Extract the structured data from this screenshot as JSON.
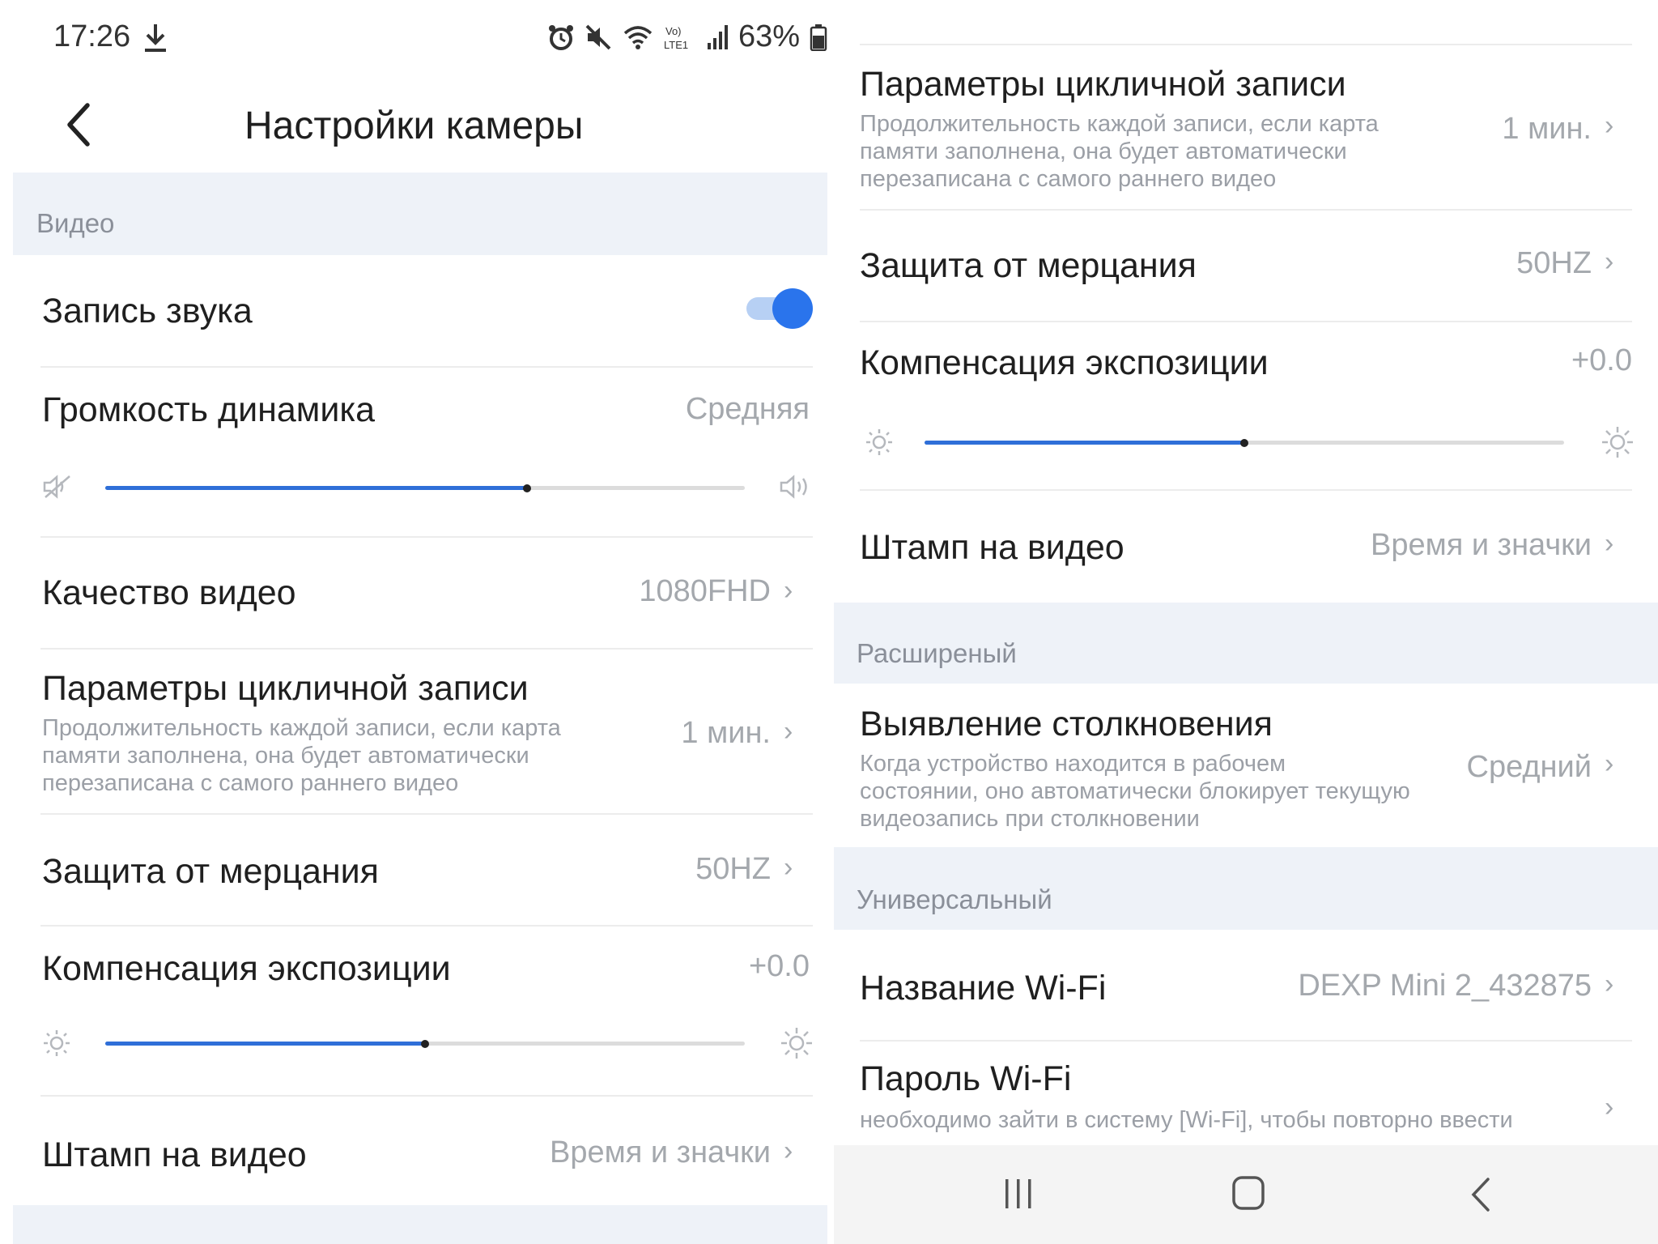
{
  "status_bar": {
    "time": "17:26",
    "battery": "63%",
    "icons": [
      "download-icon",
      "alarm-icon",
      "mute-icon",
      "wifi-icon",
      "volte-icon",
      "signal-icon",
      "battery-icon"
    ]
  },
  "header": {
    "title": "Настройки камеры",
    "back_icon": "back-icon"
  },
  "left": {
    "sections": {
      "video": "Видео"
    },
    "sound_record": {
      "label": "Запись звука",
      "enabled": true
    },
    "speaker_volume": {
      "label": "Громкость динамика",
      "value": "Средняя",
      "level_fraction": 0.66
    },
    "video_quality": {
      "label": "Качество видео",
      "value": "1080FHD"
    },
    "loop_recording": {
      "label": "Параметры цикличной записи",
      "desc_line1": "Продолжительность каждой записи, если карта",
      "desc_line2": "памяти заполнена, она будет автоматически",
      "desc_line3": "перезаписана с самого раннего видео",
      "value": "1 мин."
    },
    "flicker": {
      "label": "Защита от мерцания",
      "value": "50HZ"
    },
    "exposure": {
      "label": "Компенсация экспозиции",
      "value": "+0.0",
      "level_fraction": 0.5
    },
    "stamp": {
      "label": "Штамп на видео",
      "value": "Время и значки"
    }
  },
  "right": {
    "loop_recording": {
      "label": "Параметры цикличной записи",
      "desc_line1": "Продолжительность каждой записи, если карта",
      "desc_line2": "памяти заполнена, она будет автоматически",
      "desc_line3": "перезаписана с самого раннего видео",
      "value": "1 мин."
    },
    "flicker": {
      "label": "Защита от мерцания",
      "value": "50HZ"
    },
    "exposure": {
      "label": "Компенсация экспозиции",
      "value": "+0.0",
      "level_fraction": 0.5
    },
    "stamp": {
      "label": "Штамп на видео",
      "value": "Время и значки"
    },
    "sections": {
      "advanced": "Расширеный",
      "universal": "Универсальный"
    },
    "collision": {
      "label": "Выявление столкновения",
      "desc_line1": "Когда устройство находится в рабочем",
      "desc_line2": "состоянии, оно автоматически блокирует текущую",
      "desc_line3": "видеозапись при столкновении",
      "value": "Средний"
    },
    "wifi_name": {
      "label": "Название Wi-Fi",
      "value": "DEXP Mini 2_432875"
    },
    "wifi_password": {
      "label": "Пароль Wi-Fi",
      "desc_line1": "необходимо зайти в систему [Wi-Fi], чтобы повторно ввести"
    }
  },
  "nav_bar": {
    "icons": [
      "recents-icon",
      "home-icon",
      "back-nav-icon"
    ]
  },
  "colors": {
    "accent": "#2f6fd8",
    "section_bg": "#eef2f8",
    "muted_text": "#a4a8ad"
  }
}
